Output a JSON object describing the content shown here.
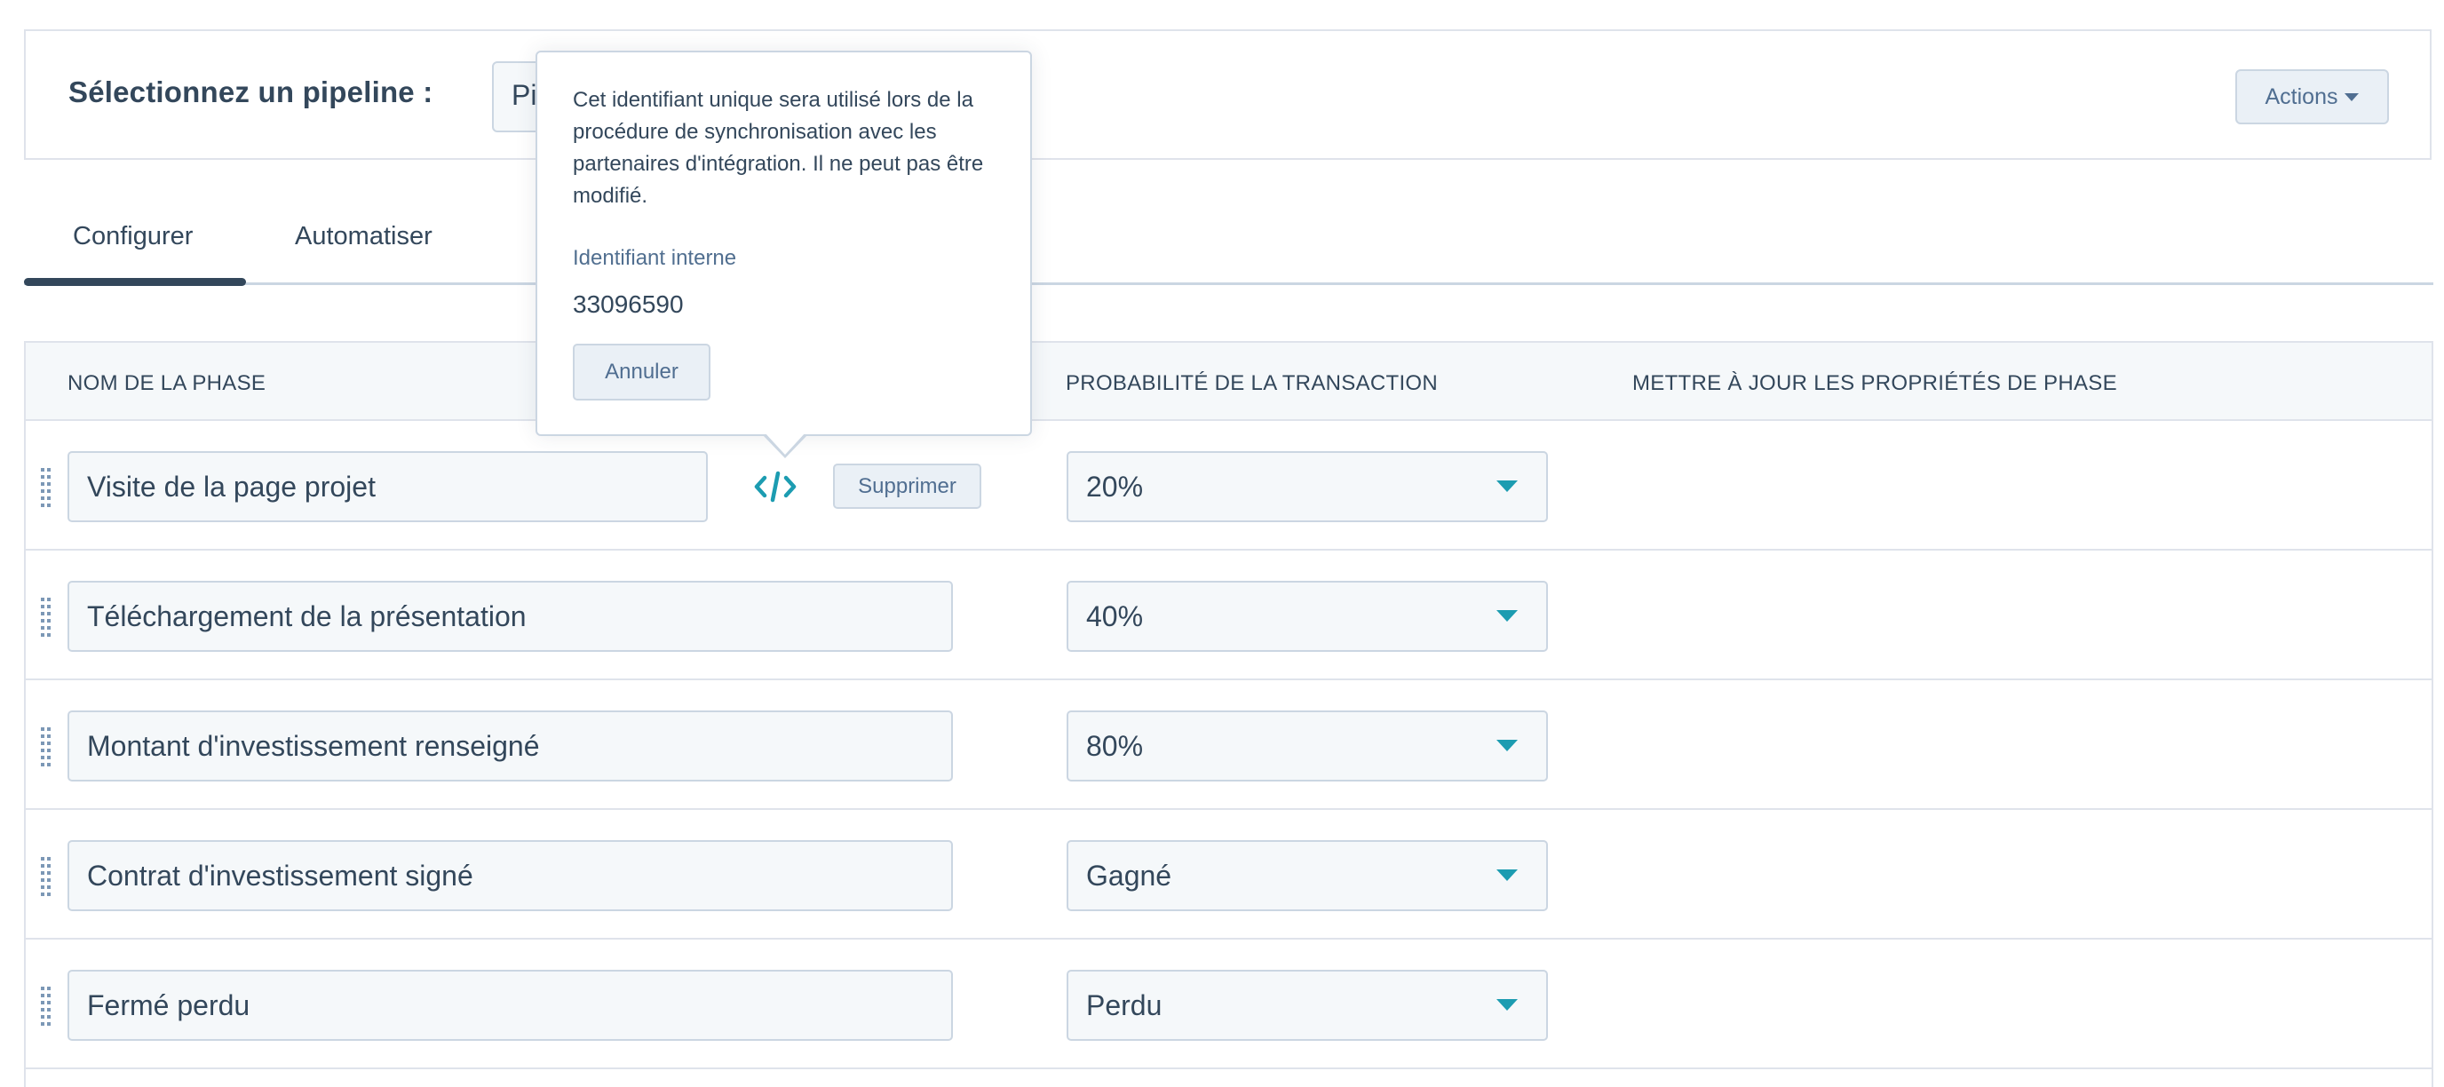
{
  "header": {
    "pipeline_label": "Sélectionnez un pipeline :",
    "pipeline_select_visible_text": "Pi",
    "actions_label": "Actions"
  },
  "tabs": [
    {
      "label": "Configurer",
      "active": true
    },
    {
      "label": "Automatiser",
      "active": false
    }
  ],
  "table": {
    "columns": {
      "name": "NOM DE LA PHASE",
      "probability": "PROBABILITÉ DE LA TRANSACTION",
      "update": "METTRE À JOUR LES PROPRIÉTÉS DE PHASE"
    },
    "delete_label": "Supprimer",
    "rows": [
      {
        "name": "Visite de la page projet",
        "probability": "20%"
      },
      {
        "name": "Téléchargement de la présentation",
        "probability": "40%"
      },
      {
        "name": "Montant d'investissement renseigné",
        "probability": "80%"
      },
      {
        "name": "Contrat d'investissement signé",
        "probability": "Gagné"
      },
      {
        "name": "Fermé perdu",
        "probability": "Perdu"
      }
    ]
  },
  "tooltip": {
    "description": "Cet identifiant unique sera utilisé lors de la procédure de synchronisation avec les partenaires d'intégration. Il ne peut pas être modifié.",
    "id_label": "Identifiant interne",
    "id_value": "33096590",
    "cancel_label": "Annuler"
  },
  "colors": {
    "accent": "#1c9cb1",
    "text": "#33475b",
    "border": "#cbd6e2",
    "header_bg": "#f5f8fa",
    "button_bg": "#eaf0f6"
  },
  "icons": {
    "code": "code-icon",
    "drag": "drag-handle-icon",
    "caret": "caret-down-icon"
  }
}
